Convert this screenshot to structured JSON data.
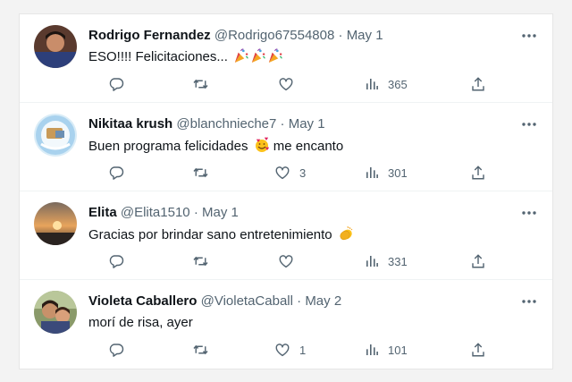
{
  "replies": [
    {
      "name": "Rodrigo Fernandez",
      "handle": "@Rodrigo67554808",
      "date": "May 1",
      "text": "ESO!!!! Felicitaciones...",
      "emoji": [
        "party-popper",
        "party-popper",
        "party-popper"
      ],
      "replies_count": "",
      "retweets_count": "",
      "likes_count": "",
      "views_count": "365"
    },
    {
      "name": "Nikitaa krush",
      "handle": "@blanchnieche7",
      "date": "May 1",
      "text": "Buen programa felicidades",
      "text_after": "me encanto",
      "emoji": [
        "face-with-hearts"
      ],
      "replies_count": "",
      "retweets_count": "",
      "likes_count": "3",
      "views_count": "301"
    },
    {
      "name": "Elita",
      "handle": "@Elita1510",
      "date": "May 1",
      "text": "Gracias por brindar sano entretenimiento",
      "emoji": [
        "clapping-hands"
      ],
      "replies_count": "",
      "retweets_count": "",
      "likes_count": "",
      "views_count": "331"
    },
    {
      "name": "Violeta Caballero",
      "handle": "@VioletaCaball",
      "date": "May 2",
      "text": "morí de risa, ayer",
      "emoji": [],
      "replies_count": "",
      "retweets_count": "",
      "likes_count": "1",
      "views_count": "101"
    }
  ],
  "separator": "·",
  "colors": {
    "text": "#0f1419",
    "secondary": "#536471",
    "divider": "#eff3f4",
    "background": "#f3f3f3"
  }
}
